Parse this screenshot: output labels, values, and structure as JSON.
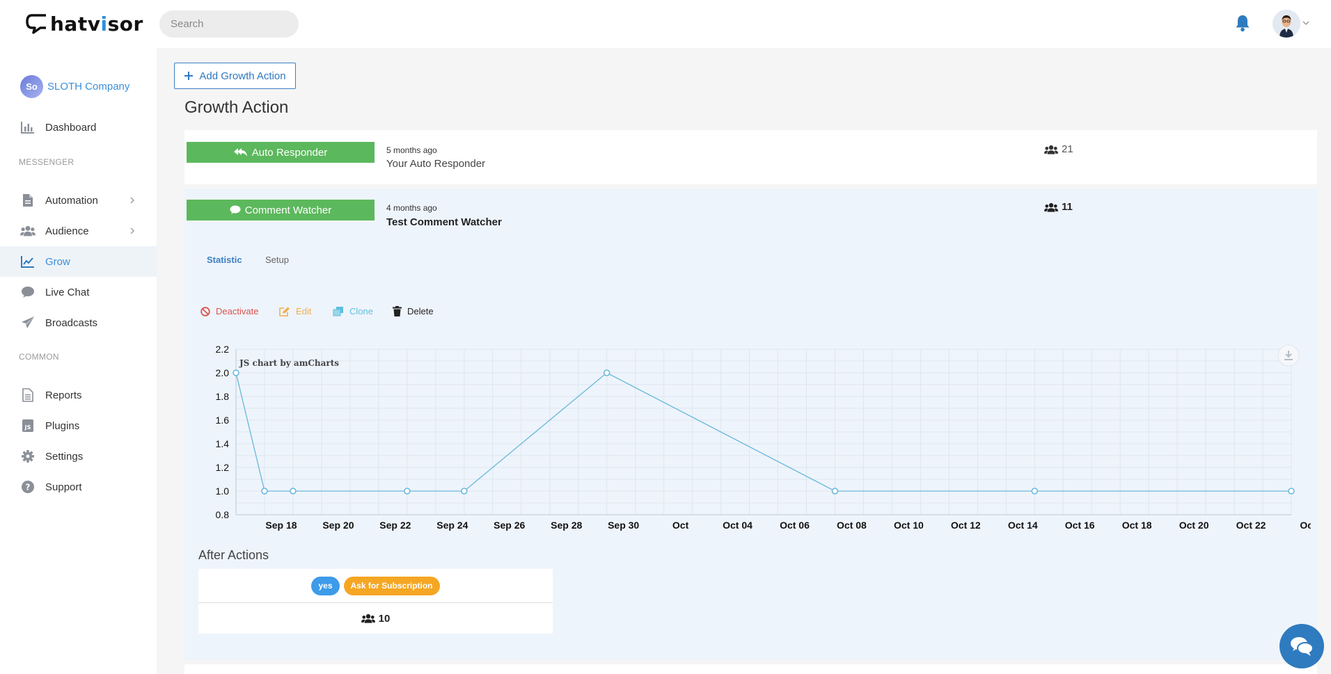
{
  "header": {
    "logo_text_pre": "hatv",
    "logo_text_i": "i",
    "logo_text_post": "sor",
    "search_placeholder": "Search"
  },
  "sidebar": {
    "company_name": "SLOTH Company",
    "company_initials": "So",
    "sections": [
      "MESSENGER",
      "COMMON"
    ],
    "items": [
      {
        "label": "Dashboard"
      },
      {
        "label": "Automation"
      },
      {
        "label": "Audience"
      },
      {
        "label": "Grow"
      },
      {
        "label": "Live Chat"
      },
      {
        "label": "Broadcasts"
      },
      {
        "label": "Reports"
      },
      {
        "label": "Plugins"
      },
      {
        "label": "Settings"
      },
      {
        "label": "Support"
      }
    ]
  },
  "main": {
    "add_button_label": "Add Growth Action",
    "title": "Growth Action",
    "actions": [
      {
        "type_label": "Auto Responder",
        "ago": "5 months ago",
        "name": "Your Auto Responder",
        "count": "21"
      },
      {
        "type_label": "Comment Watcher",
        "ago": "4 months ago",
        "name": "Test Comment Watcher",
        "count": "11"
      }
    ],
    "tabs": [
      {
        "label": "Statistic"
      },
      {
        "label": "Setup"
      }
    ],
    "toolbar": {
      "deactivate": "Deactivate",
      "edit": "Edit",
      "clone": "Clone",
      "delete": "Delete"
    },
    "after_actions": {
      "title": "After Actions",
      "badge_yes": "yes",
      "badge_subscription": "Ask for Subscription",
      "count": "10"
    }
  },
  "colors": {
    "accent": "#3b8fd9",
    "green_tag": "#5cb85c",
    "line": "#67b7dc",
    "deactivate": "#d9534f",
    "edit": "#f0ad4e",
    "clone": "#5bc0de"
  },
  "chart_data": {
    "type": "line",
    "watermark": "JS chart by amCharts",
    "ylim": [
      0.8,
      2.2
    ],
    "y_ticks": [
      "0.8",
      "1.0",
      "1.2",
      "1.4",
      "1.6",
      "1.8",
      "2.0",
      "2.2"
    ],
    "x_tick_labels": [
      "Sep 18",
      "Sep 20",
      "Sep 22",
      "Sep 24",
      "Sep 26",
      "Sep 28",
      "Sep 30",
      "Oct",
      "Oct 04",
      "Oct 06",
      "Oct 08",
      "Oct 10",
      "Oct 12",
      "Oct 14",
      "Oct 16",
      "Oct 18",
      "Oct 20",
      "Oct 22",
      "Oct"
    ],
    "xlim": [
      "Sep 17",
      "Oct 24"
    ],
    "series": [
      {
        "points": [
          {
            "x": "Sep 17",
            "y": 2
          },
          {
            "x": "Sep 18",
            "y": 1
          },
          {
            "x": "Sep 19",
            "y": 1
          },
          {
            "x": "Sep 23",
            "y": 1
          },
          {
            "x": "Sep 25",
            "y": 1
          },
          {
            "x": "Sep 30",
            "y": 2
          },
          {
            "x": "Oct 08",
            "y": 1
          },
          {
            "x": "Oct 15",
            "y": 1
          },
          {
            "x": "Oct 24",
            "y": 1
          }
        ]
      }
    ],
    "grid": true
  }
}
